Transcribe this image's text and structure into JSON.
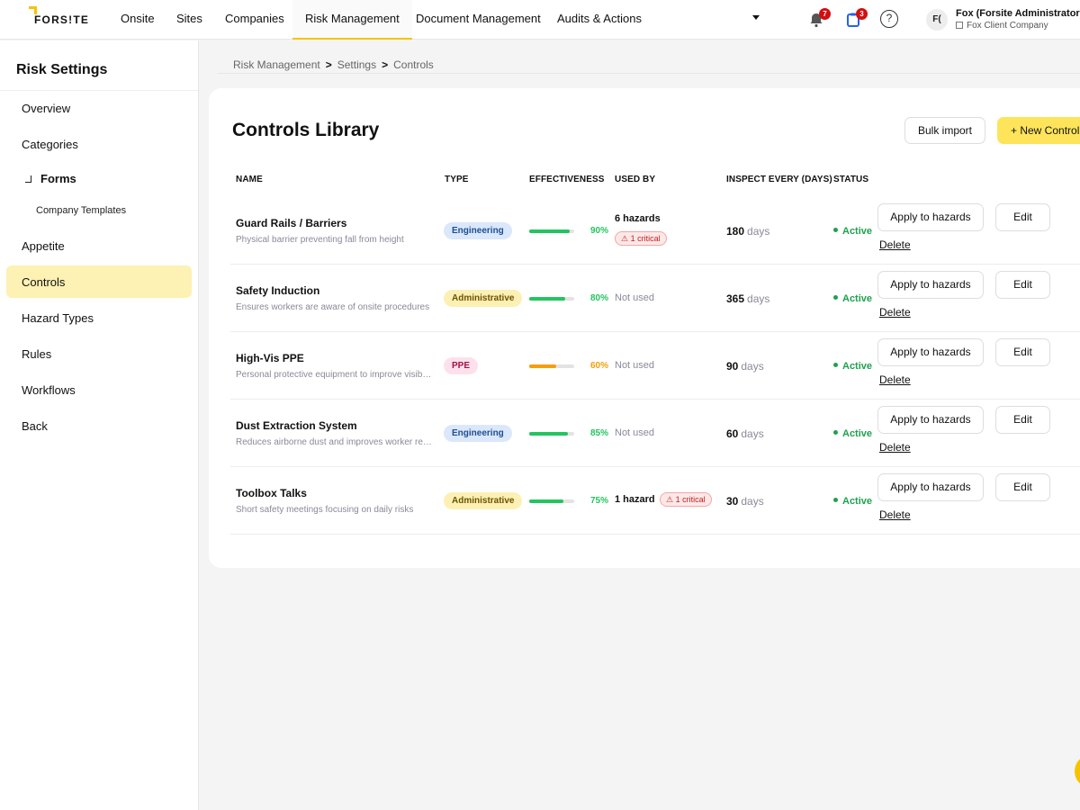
{
  "nav": {
    "logo": "FORS!TE",
    "items": [
      "Onsite",
      "Sites",
      "Companies",
      "Risk Management",
      "Document Management",
      "Audits & Actions"
    ],
    "active": "Risk Management",
    "notifications_count": "7",
    "tasks_count": "3",
    "help_icon": "?",
    "avatar_initials": "F(",
    "user_name": "Fox (Forsite Administrator)",
    "user_company": "Fox Client Company"
  },
  "sidebar": {
    "title": "Risk Settings",
    "items": {
      "overview": "Overview",
      "categories": "Categories",
      "forms": "Forms",
      "company_templates": "Company Templates",
      "appetite": "Appetite",
      "controls": "Controls",
      "hazard_types": "Hazard Types",
      "rules": "Rules",
      "workflows": "Workflows",
      "back": "Back"
    }
  },
  "breadcrumb": [
    "Risk Management",
    "Settings",
    "Controls"
  ],
  "page": {
    "title": "Controls Library",
    "bulk_import": "Bulk import",
    "new_control": "+ New Control"
  },
  "table": {
    "headers": [
      "NAME",
      "TYPE",
      "EFFECTIVENESS",
      "USED BY",
      "INSPECT EVERY (DAYS)",
      "STATUS"
    ],
    "days_unit": "days",
    "apply_label": "Apply to hazards",
    "edit_label": "Edit",
    "delete_label": "Delete",
    "rows": [
      {
        "name": "Guard Rails / Barriers",
        "desc": "Physical barrier preventing fall from height",
        "type": "Engineering",
        "effectiveness": "90%",
        "effectiveness_value": 0.9,
        "used_by": "6 hazards",
        "critical": "1 critical",
        "days": "180",
        "status": "Active"
      },
      {
        "name": "Safety Induction",
        "desc": "Ensures workers are aware of onsite procedures",
        "type": "Administrative",
        "effectiveness": "80%",
        "effectiveness_value": 0.8,
        "used_by": "Not used",
        "critical": "",
        "days": "365",
        "status": "Active"
      },
      {
        "name": "High-Vis PPE",
        "desc": "Personal protective equipment to improve visib…",
        "type": "PPE",
        "effectiveness": "60%",
        "effectiveness_value": 0.6,
        "used_by": "Not used",
        "critical": "",
        "days": "90",
        "status": "Active"
      },
      {
        "name": "Dust Extraction System",
        "desc": "Reduces airborne dust and improves worker re…",
        "type": "Engineering",
        "effectiveness": "85%",
        "effectiveness_value": 0.85,
        "used_by": "Not used",
        "critical": "",
        "days": "60",
        "status": "Active"
      },
      {
        "name": "Toolbox Talks",
        "desc": "Short safety meetings focusing on daily risks",
        "type": "Administrative",
        "effectiveness": "75%",
        "effectiveness_value": 0.75,
        "used_by": "1 hazard",
        "critical": "1 critical",
        "days": "30",
        "status": "Active"
      }
    ]
  },
  "colors": {
    "accent": "#fde45a",
    "effect_high": "#22c55e",
    "effect_mid": "#f59e0b",
    "active_status": "#1fa14d",
    "critical": "#c21f1f"
  }
}
